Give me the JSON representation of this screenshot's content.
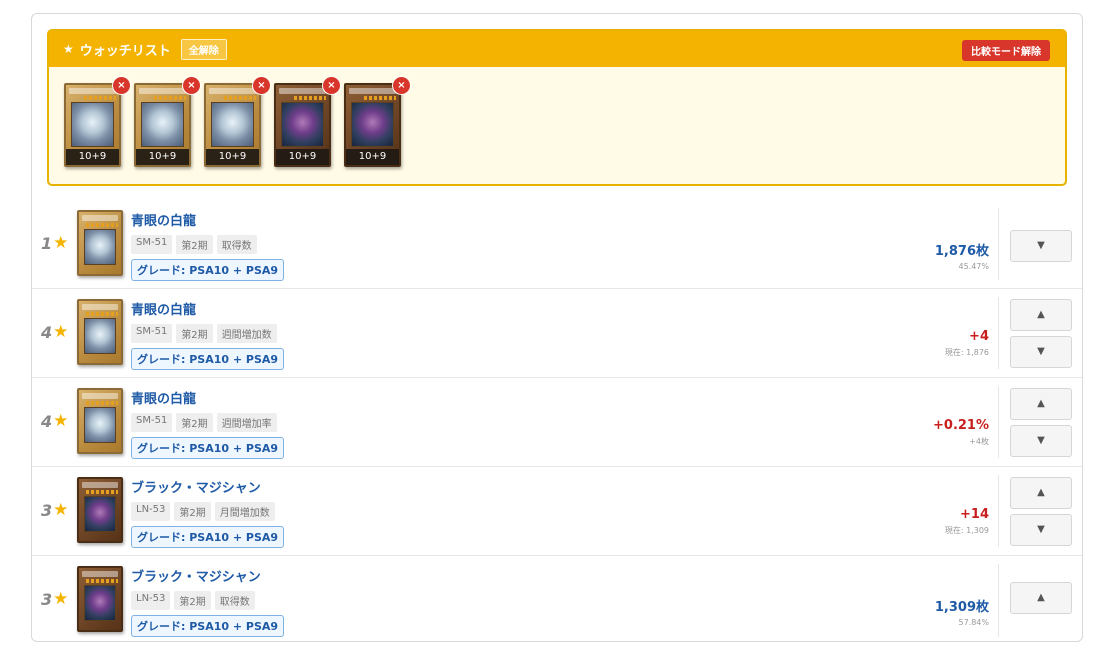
{
  "watchlist": {
    "title": "ウォッチリスト",
    "star": "★",
    "clear_all": "全解除",
    "exit_compare": "比較モード解除",
    "remove_glyph": "×",
    "cards": [
      {
        "art": "dragon",
        "grade": "10+9"
      },
      {
        "art": "dragon",
        "grade": "10+9"
      },
      {
        "art": "dragon",
        "grade": "10+9"
      },
      {
        "art": "magician",
        "grade": "10+9"
      },
      {
        "art": "magician",
        "grade": "10+9"
      }
    ]
  },
  "rows": [
    {
      "rank": "1",
      "title": "青眼の白龍",
      "tags": [
        "SM-51",
        "第2期",
        "取得数"
      ],
      "grade": "グレード: PSA10 + PSA9",
      "value": "1,876枚",
      "value_color": "blue",
      "sub": "45.47%",
      "buttons": [
        "▼"
      ],
      "art": "dragon"
    },
    {
      "rank": "4",
      "title": "青眼の白龍",
      "tags": [
        "SM-51",
        "第2期",
        "週間増加数"
      ],
      "grade": "グレード: PSA10 + PSA9",
      "value": "+4",
      "value_color": "red",
      "sub": "現在: 1,876",
      "buttons": [
        "▲",
        "▼"
      ],
      "art": "dragon"
    },
    {
      "rank": "4",
      "title": "青眼の白龍",
      "tags": [
        "SM-51",
        "第2期",
        "週間増加率"
      ],
      "grade": "グレード: PSA10 + PSA9",
      "value": "+0.21%",
      "value_color": "red",
      "sub": "+4枚",
      "buttons": [
        "▲",
        "▼"
      ],
      "art": "dragon"
    },
    {
      "rank": "3",
      "title": "ブラック・マジシャン",
      "tags": [
        "LN-53",
        "第2期",
        "月間増加数"
      ],
      "grade": "グレード: PSA10 + PSA9",
      "value": "+14",
      "value_color": "red",
      "sub": "現在: 1,309",
      "buttons": [
        "▲",
        "▼"
      ],
      "art": "magician"
    },
    {
      "rank": "3",
      "title": "ブラック・マジシャン",
      "tags": [
        "LN-53",
        "第2期",
        "取得数"
      ],
      "grade": "グレード: PSA10 + PSA9",
      "value": "1,309枚",
      "value_color": "blue",
      "sub": "57.84%",
      "buttons": [
        "▲"
      ],
      "art": "magician"
    }
  ],
  "rank_star": "★",
  "colors": {
    "accent": "#f3b300",
    "link": "#1e5aa6",
    "danger": "#d9362b",
    "up": "#c81e1e"
  }
}
